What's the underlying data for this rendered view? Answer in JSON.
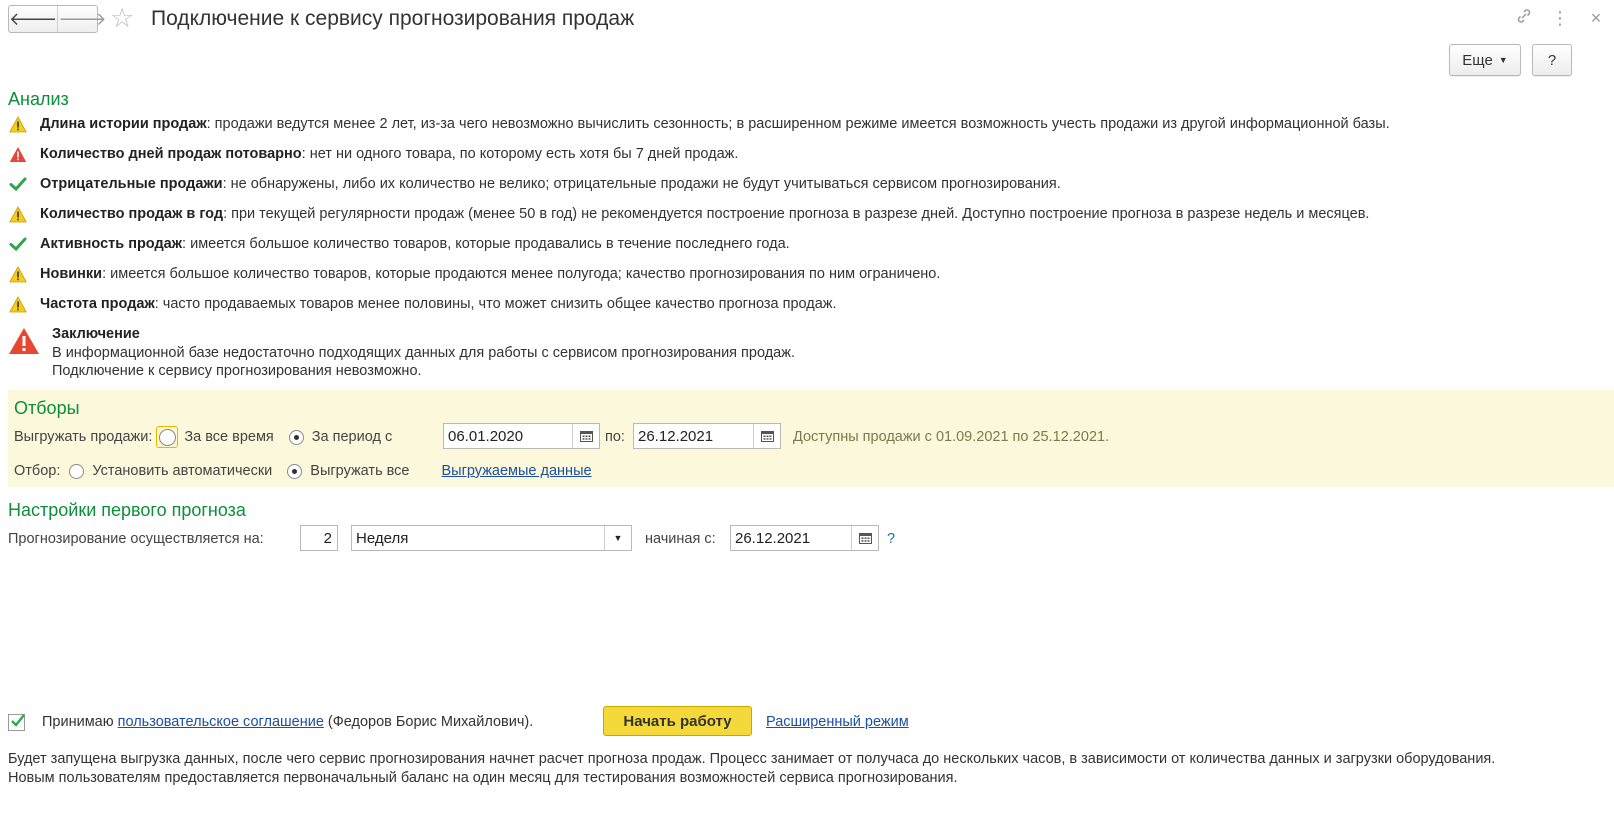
{
  "window": {
    "title": "Подключение к сервису прогнозирования продаж",
    "more_label": "Еще",
    "help_label": "?"
  },
  "analysis": {
    "title": "Анализ",
    "items": [
      {
        "status": "warning",
        "label": "Длина истории продаж",
        "text": ": продажи ведутся менее 2 лет, из-за чего невозможно вычислить сезонность; в расширенном режиме имеется возможность учесть продажи из другой информационной базы."
      },
      {
        "status": "error",
        "label": "Количество дней продаж потоварно",
        "text": ": нет ни одного товара, по которому есть хотя бы 7 дней продаж."
      },
      {
        "status": "ok",
        "label": "Отрицательные продажи",
        "text": ": не обнаружены, либо их количество не велико; отрицательные продажи не будут учитываться сервисом прогнозирования."
      },
      {
        "status": "warning",
        "label": "Количество продаж в год",
        "text": ": при текущей регулярности продаж (менее 50 в год) не рекомендуется построение прогноза в разрезе дней. Доступно построение прогноза в разрезе недель и месяцев."
      },
      {
        "status": "ok",
        "label": "Активность продаж",
        "text": ": имеется большое количество товаров, которые продавались в течение последнего года."
      },
      {
        "status": "warning",
        "label": "Новинки",
        "text": ": имеется большое количество товаров, которые продаются менее полугода; качество прогнозирования по ним ограничено."
      },
      {
        "status": "warning",
        "label": "Частота продаж",
        "text": ": часто продаваемых товаров менее половины, что может снизить общее качество прогноза продаж."
      }
    ],
    "conclusion": {
      "title": "Заключение",
      "line1": "В информационной базе недостаточно подходящих данных для работы с сервисом прогнозирования продаж.",
      "line2": "Подключение к сервису прогнозирования невозможно."
    }
  },
  "filters": {
    "title": "Отборы",
    "export_label": "Выгружать продажи:",
    "all_time_label": "За все время",
    "period_label": "За период с",
    "date_from": "06.01.2020",
    "to_label": "по:",
    "date_to": "26.12.2021",
    "available_hint": "Доступны продажи с 01.09.2021 по 25.12.2021.",
    "selection_label": "Отбор:",
    "auto_label": "Установить автоматически",
    "export_all_label": "Выгружать все",
    "exported_data_link": "Выгружаемые данные"
  },
  "forecast": {
    "title": "Настройки первого прогноза",
    "label": "Прогнозирование осуществляется на:",
    "count": "2",
    "period": "Неделя",
    "starting_label": "начиная с:",
    "start_date": "26.12.2021",
    "help": "?"
  },
  "footer": {
    "accept_label": "Принимаю",
    "agreement_link": "пользовательское соглашение",
    "user_name": "(Федоров Борис Михайлович).",
    "start_button": "Начать работу",
    "advanced_link": "Расширенный режим",
    "info_line1": "Будет запущена выгрузка данных, после чего сервис прогнозирования начнет расчет прогноза продаж. Процесс занимает от получаса до нескольких часов, в зависимости от количества данных и загрузки оборудования.",
    "info_line2": "Новым пользователям предоставляется первоначальный баланс на один месяц для тестирования возможностей сервиса прогнозирования."
  },
  "colors": {
    "section_title": "#0d8f3a",
    "warning": "#f2c200",
    "error": "#e03c31",
    "ok": "#2ca84a",
    "filters_bg": "#fcf8dc",
    "primary_button": "#f5d93a",
    "link": "#1c4fa5"
  }
}
